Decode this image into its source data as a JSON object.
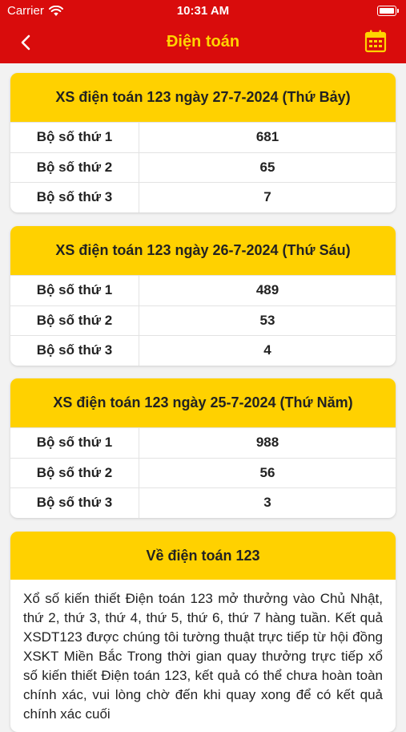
{
  "status_bar": {
    "carrier": "Carrier",
    "time": "10:31 AM"
  },
  "navbar": {
    "title": "Điện toán"
  },
  "colors": {
    "header": "#d90c0c",
    "title": "#ffd400",
    "card_head": "#ffd100"
  },
  "results": [
    {
      "title": "XS điện toán 123 ngày 27-7-2024 (Thứ Bảy)",
      "rows": [
        {
          "label": "Bộ số thứ 1",
          "value": "681"
        },
        {
          "label": "Bộ số thứ 2",
          "value": "65"
        },
        {
          "label": "Bộ số thứ 3",
          "value": "7"
        }
      ]
    },
    {
      "title": "XS điện toán 123 ngày 26-7-2024 (Thứ Sáu)",
      "rows": [
        {
          "label": "Bộ số thứ 1",
          "value": "489"
        },
        {
          "label": "Bộ số thứ 2",
          "value": "53"
        },
        {
          "label": "Bộ số thứ 3",
          "value": "4"
        }
      ]
    },
    {
      "title": "XS điện toán 123 ngày 25-7-2024 (Thứ Năm)",
      "rows": [
        {
          "label": "Bộ số thứ 1",
          "value": "988"
        },
        {
          "label": "Bộ số thứ 2",
          "value": "56"
        },
        {
          "label": "Bộ số thứ 3",
          "value": "3"
        }
      ]
    }
  ],
  "about": {
    "title": "Về điện toán 123",
    "text": "Xổ số kiến thiết Điện toán 123 mở thưởng vào Chủ Nhật, thứ 2, thứ 3, thứ 4, thứ 5, thứ 6, thứ 7 hàng tuần. Kết quả XSDT123 được chúng tôi tường thuật trực tiếp từ hội đồng XSKT Miền Bắc Trong thời gian quay thưởng trực tiếp xổ số kiến thiết Điện toán 123, kết quả có thể chưa hoàn toàn chính xác, vui lòng chờ đến khi quay xong để có kết quả chính xác cuối"
  }
}
